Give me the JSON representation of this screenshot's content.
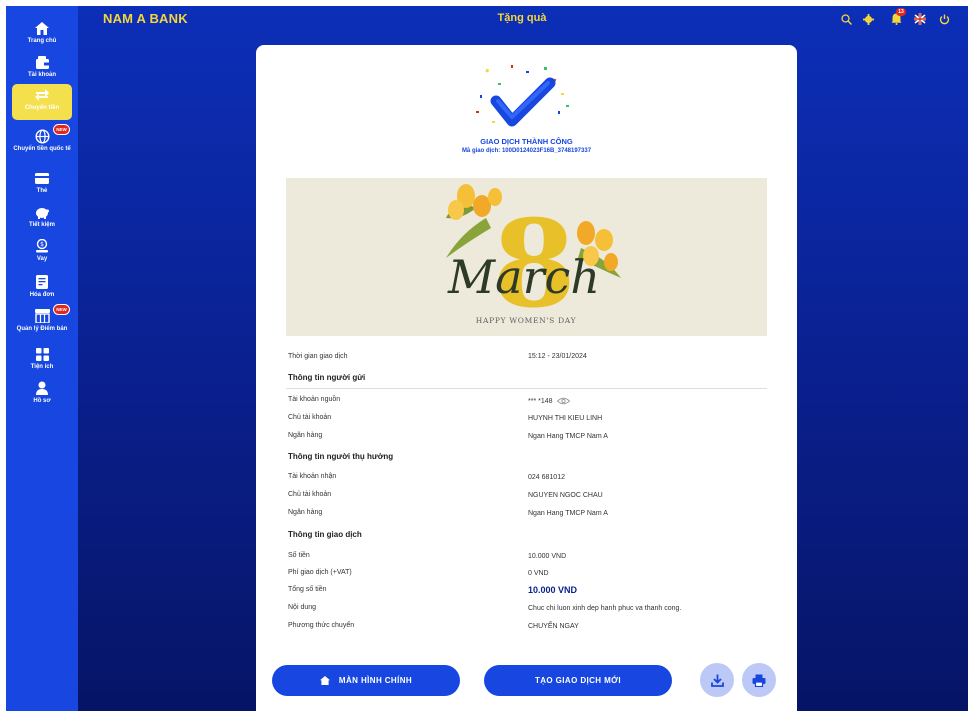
{
  "app": {
    "brand": "NAM A BANK",
    "title": "Tặng quà"
  },
  "sidebar": {
    "items": [
      {
        "label": "Trang chủ",
        "icon": "home-icon"
      },
      {
        "label": "Tài khoản",
        "icon": "wallet-icon"
      },
      {
        "label": "Chuyển tiền",
        "icon": "transfer-icon",
        "active": true
      },
      {
        "label": "Chuyển tiền quốc tế",
        "icon": "globe-icon",
        "badge": "NEW"
      },
      {
        "label": "Thẻ",
        "icon": "card-icon"
      },
      {
        "label": "Tiết kiệm",
        "icon": "piggy-bank-icon"
      },
      {
        "label": "Vay",
        "icon": "loan-icon"
      },
      {
        "label": "Hóa đơn",
        "icon": "bill-icon"
      },
      {
        "label": "Quản lý Điểm bán",
        "icon": "store-icon",
        "badge": "NEW"
      },
      {
        "label": "Tiện ích",
        "icon": "grid-icon"
      },
      {
        "label": "Hồ sơ",
        "icon": "profile-icon"
      }
    ]
  },
  "topbar": {
    "notification_count": "13",
    "icons": [
      "search-icon",
      "gear-icon",
      "bell-icon",
      "uk-flag-icon",
      "power-icon"
    ]
  },
  "receipt": {
    "status": "GIAO DỊCH THÀNH CÔNG",
    "txn_code_label": "Mã giao dịch:",
    "txn_code": "100D0124023F16B_3748197337",
    "banner_caption": "HAPPY WOMEN'S DAY",
    "banner_word": "March",
    "banner_number": "8",
    "time_label": "Thời gian giao dịch",
    "time_value": "15:12 - 23/01/2024",
    "sender": {
      "title": "Thông tin người gửi",
      "account_label": "Tài khoản nguồn",
      "account_value": "*** *148",
      "owner_label": "Chủ tài khoản",
      "owner_value": "HUYNH THI KIEU LINH",
      "bank_label": "Ngân hàng",
      "bank_value": "Ngan Hang TMCP Nam A"
    },
    "beneficiary": {
      "title": "Thông tin người thụ hưởng",
      "account_label": "Tài khoản nhận",
      "account_value": "024 681012",
      "owner_label": "Chủ tài khoản",
      "owner_value": "NGUYEN NGOC CHAU",
      "bank_label": "Ngân hàng",
      "bank_value": "Ngan Hang TMCP Nam A"
    },
    "transaction": {
      "title": "Thông tin giao dịch",
      "amount_label": "Số tiền",
      "amount_value": "10.000 VND",
      "fee_label": "Phí giao dịch (+VAT)",
      "fee_value": "0 VND",
      "total_label": "Tổng số tiền",
      "total_value": "10.000 VND",
      "content_label": "Nội dung",
      "content_value": "Chuc chi luon xinh dep hanh phuc va thanh cong.",
      "method_label": "Phương thức chuyển",
      "method_value": "CHUYỂN NGAY"
    },
    "buttons": {
      "home": "MÀN HÌNH CHÍNH",
      "new_txn": "TẠO GIAO DỊCH MỚI"
    }
  },
  "colors": {
    "primary": "#1747e0",
    "accent_yellow": "#f5d638",
    "badge_red": "#e0281e",
    "background_dark": "#0a1f8c"
  }
}
